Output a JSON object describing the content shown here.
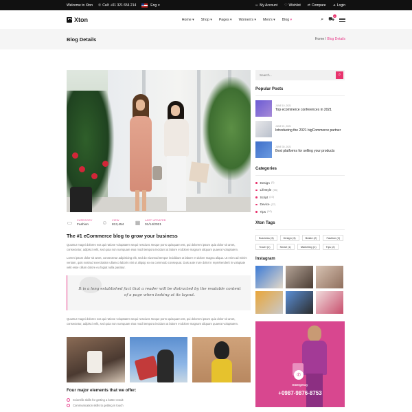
{
  "topbar": {
    "welcome": "Welcome to Xton",
    "call": "Call: +01 321 654 214",
    "language": "Eng",
    "my_account": "My Account",
    "wishlist": "Wishlist",
    "compare": "Compare",
    "login": "Login"
  },
  "header": {
    "logo": "Xton",
    "nav": [
      "Home",
      "Shop",
      "Pages",
      "Women's",
      "Men's",
      "Blog"
    ],
    "active_nav": "Blog",
    "cart_count": "0"
  },
  "titleband": {
    "title": "Blog Details",
    "breadcrumb_home": "Home",
    "breadcrumb_sep": "/",
    "breadcrumb_current": "Blog Details"
  },
  "article": {
    "meta": [
      {
        "label": "CATEGORY",
        "value": "Fashion",
        "icon": "folder-icon"
      },
      {
        "label": "VIEW",
        "value": "813,454",
        "icon": "user-icon"
      },
      {
        "label": "LAST UPDATED",
        "value": "01/14/2021",
        "icon": "calendar-icon"
      }
    ],
    "title": "The #1 eCommerce blog to grow your business",
    "para1": "Quuntur magni dolores eos qui ratione voluptatem sequi nesciunt. Neque porro quisquam est, qui dolorem ipsum quia dolor sit amet, consectetur, adipisci velit, sed quia non numquam eius modi tempora incidunt ut labore et dolore magnam aliquam quaerat voluptatem.",
    "para2": "Lorem ipsum dolor sit amet, consectetur adipisicing elit, sed do eiusmod tempor incididunt ut labore et dolore magna aliqua. Ut enim ad minim veniam, quis nostrud exercitation ullamco laboris nisi ut aliquip ex ea commodo consequat. Duis aute irure dolor in reprehenderit in voluptate velit esse cillum dolore eu fugiat nulla pariatur.",
    "quote": "It is a long established fact that a reader will be distracted by the readable content of a page when looking at its layout.",
    "para3": "Quuntur magni dolores eos qui ratione voluptatem sequi nesciunt. Neque porro quisquam est, qui dolorem ipsum quia dolor sit amet, consectetur, adipisci velit, sed quia non numquam eius modi tempora incidunt ut labore et dolore magnam aliquam quaerat voluptatem.",
    "features_title": "Four major elements that we offer:",
    "features": [
      "Scientific skills for getting a better result",
      "Communication skills to getting in touch"
    ]
  },
  "sidebar": {
    "search_placeholder": "Search...",
    "popular_title": "Popular Posts",
    "posts": [
      {
        "date": "JUNE 10, 2021",
        "title": "Top ecommerce conferences in 2021"
      },
      {
        "date": "JUNE 21, 2021",
        "title": "Introducing the 2021 bigCommerce partner"
      },
      {
        "date": "JUNE 30, 2021",
        "title": "Best platforms for selling your products"
      }
    ],
    "categories_title": "Categories",
    "categories": [
      {
        "name": "Design",
        "count": "(3)"
      },
      {
        "name": "Lifestyle",
        "count": "(55)"
      },
      {
        "name": "Script",
        "count": "(10)"
      },
      {
        "name": "Device",
        "count": "(27)"
      },
      {
        "name": "Tips",
        "count": "(10)"
      }
    ],
    "tags_title": "Xton Tags",
    "tags": [
      "Business (3)",
      "Design (3)",
      "Braike (2)",
      "Fashion (2)",
      "Travel (1)",
      "Smart (1)",
      "Marketing (1)",
      "Tips (2)"
    ],
    "instagram_title": "Instagram",
    "promo_label": "Emergency",
    "promo_phone": "+0987-9876-8753"
  },
  "colors": {
    "accent": "#e8336d",
    "dark": "#111111"
  }
}
